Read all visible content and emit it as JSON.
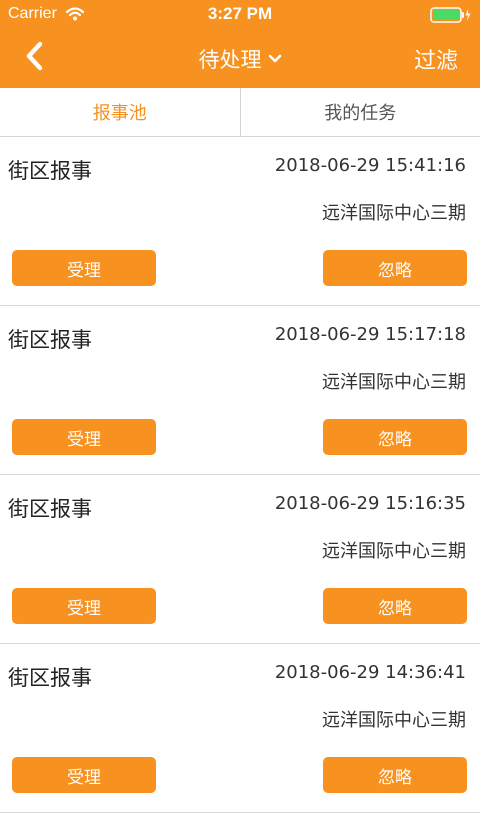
{
  "status_bar": {
    "carrier": "Carrier",
    "time": "3:27 PM"
  },
  "nav": {
    "title": "待处理",
    "filter_label": "过滤"
  },
  "tabs": [
    {
      "label": "报事池",
      "active": true
    },
    {
      "label": "我的任务",
      "active": false
    }
  ],
  "reports": [
    {
      "title": "街区报事",
      "time": "2018-06-29 15:41:16",
      "location": "远洋国际中心三期",
      "accept_label": "受理",
      "ignore_label": "忽略"
    },
    {
      "title": "街区报事",
      "time": "2018-06-29 15:17:18",
      "location": "远洋国际中心三期",
      "accept_label": "受理",
      "ignore_label": "忽略"
    },
    {
      "title": "街区报事",
      "time": "2018-06-29 15:16:35",
      "location": "远洋国际中心三期",
      "accept_label": "受理",
      "ignore_label": "忽略"
    },
    {
      "title": "街区报事",
      "time": "2018-06-29 14:36:41",
      "location": "远洋国际中心三期",
      "accept_label": "受理",
      "ignore_label": "忽略"
    }
  ],
  "colors": {
    "accent": "#f7911f",
    "divider": "#d5d5d5"
  }
}
